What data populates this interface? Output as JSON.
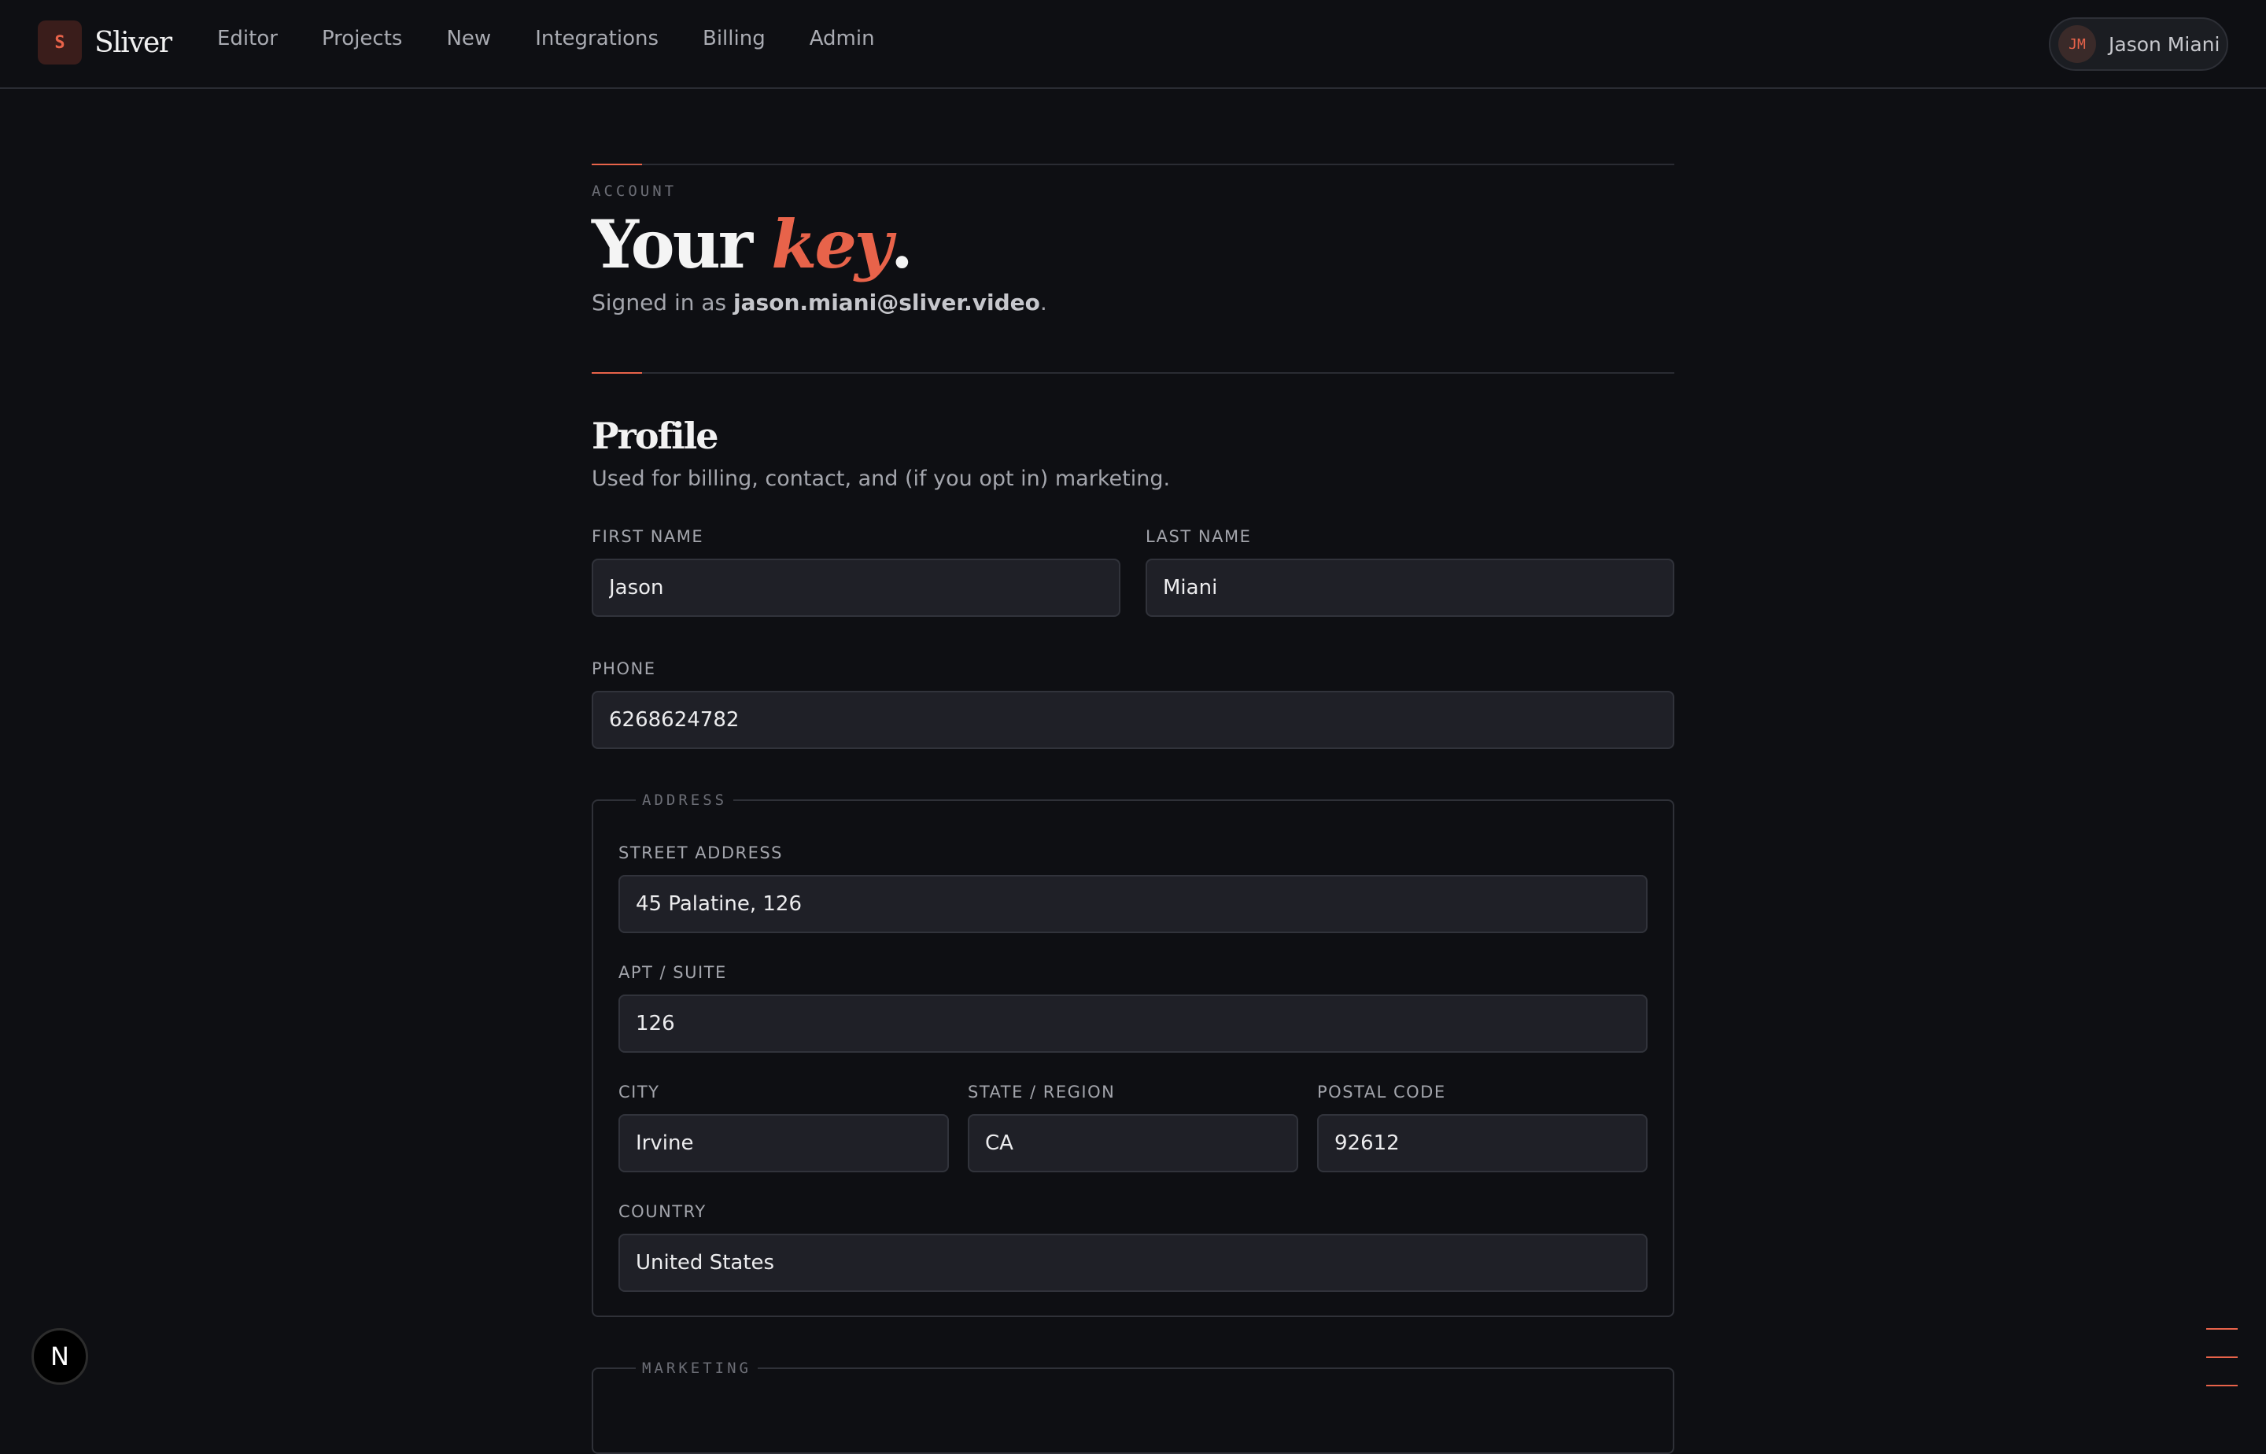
{
  "app": {
    "brand_initial": "S",
    "brand_name": "Sliver"
  },
  "nav": {
    "items": [
      "Editor",
      "Projects",
      "New",
      "Integrations",
      "Billing",
      "Admin"
    ]
  },
  "user": {
    "initials": "JM",
    "name": "Jason Miani"
  },
  "header": {
    "eyebrow": "ACCOUNT",
    "title_prefix": "Your ",
    "title_emphasis": "key",
    "title_suffix": ".",
    "signed_in_prefix": "Signed in as ",
    "email": "jason.miani@sliver.video",
    "signed_in_suffix": "."
  },
  "profile": {
    "title": "Profile",
    "subtitle": "Used for billing, contact, and (if you opt in) marketing.",
    "first_name": {
      "label": "FIRST NAME",
      "value": "Jason"
    },
    "last_name": {
      "label": "LAST NAME",
      "value": "Miani"
    },
    "phone": {
      "label": "PHONE",
      "value": "6268624782"
    }
  },
  "address": {
    "legend": "ADDRESS",
    "street": {
      "label": "STREET ADDRESS",
      "value": "45 Palatine, 126"
    },
    "apt": {
      "label": "APT / SUITE",
      "value": "126"
    },
    "city": {
      "label": "CITY",
      "value": "Irvine"
    },
    "state": {
      "label": "STATE / REGION",
      "value": "CA"
    },
    "postal": {
      "label": "POSTAL CODE",
      "value": "92612"
    },
    "country": {
      "label": "COUNTRY",
      "value": "United States"
    }
  },
  "marketing": {
    "legend": "MARKETING"
  },
  "widgets": {
    "next_badge": "N"
  },
  "theme": {
    "accent": "#e8634a",
    "background": "#0e0f13",
    "input_bg": "#1f2027"
  }
}
